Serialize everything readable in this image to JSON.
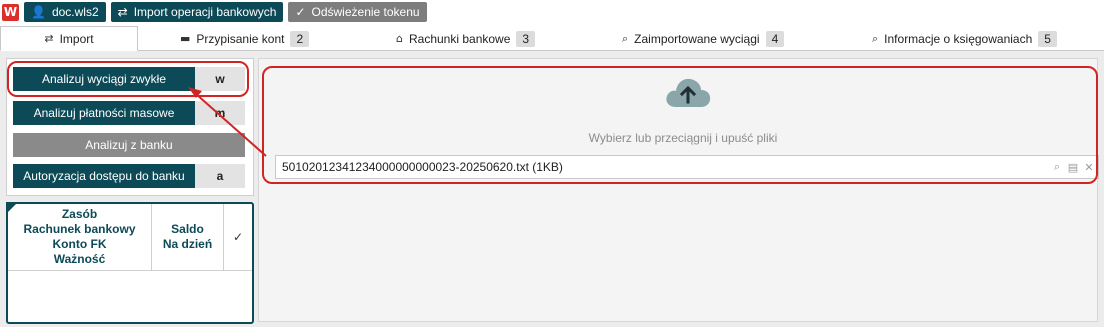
{
  "toolbar": {
    "logo_letter": "W",
    "doc_label": "doc.wls2",
    "import_label": "Import operacji bankowych",
    "refresh_label": "Odświeżenie tokenu"
  },
  "tabs": [
    {
      "label": "Import",
      "badge": ""
    },
    {
      "label": "Przypisanie kont",
      "badge": "2"
    },
    {
      "label": "Rachunki bankowe",
      "badge": "3"
    },
    {
      "label": "Zaimportowane wyciągi",
      "badge": "4"
    },
    {
      "label": "Informacje o księgowaniach",
      "badge": "5"
    }
  ],
  "actions": [
    {
      "label": "Analizuj wyciągi zwykłe",
      "key": "w"
    },
    {
      "label": "Analizuj płatności masowe",
      "key": "m"
    },
    {
      "label": "Analizuj z banku",
      "key": ""
    },
    {
      "label": "Autoryzacja dostępu do banku",
      "key": "a"
    }
  ],
  "table": {
    "col1": [
      "Zasób",
      "Rachunek bankowy",
      "Konto FK",
      "Ważność"
    ],
    "col2": [
      "Saldo",
      "Na dzień"
    ],
    "col3": "✓"
  },
  "upload": {
    "hint": "Wybierz lub przeciągnij i upuść pliki",
    "file_name": "50102012341234000000000023-20250620.txt (1KB)"
  },
  "colors": {
    "accent": "#0d4a57",
    "annotation": "#d32424",
    "cloud": "#8aa6ab"
  }
}
